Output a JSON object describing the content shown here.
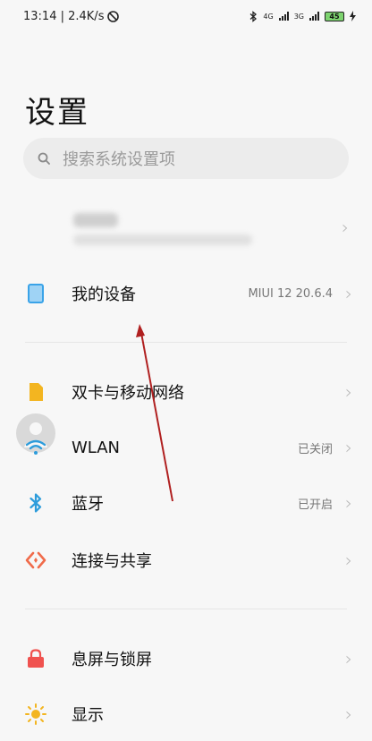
{
  "status_bar": {
    "time_speed": "13:14 | 2.4K/s",
    "signal1_label": "4G",
    "signal2_label": "3G",
    "battery": "45"
  },
  "page": {
    "title": "设置"
  },
  "search": {
    "placeholder": "搜索系统设置项"
  },
  "items": {
    "my_device": {
      "label": "我的设备",
      "value": "MIUI 12 20.6.4"
    },
    "sim": {
      "label": "双卡与移动网络"
    },
    "wlan": {
      "label": "WLAN",
      "value": "已关闭"
    },
    "bluetooth": {
      "label": "蓝牙",
      "value": "已开启"
    },
    "connection": {
      "label": "连接与共享"
    },
    "lockscreen": {
      "label": "息屏与锁屏"
    },
    "display": {
      "label": "显示"
    }
  },
  "colors": {
    "my_device_icon": "#3aa3e8",
    "sim_icon": "#f3b520",
    "wlan_icon": "#2d9cdb",
    "bluetooth_icon": "#2d9cdb",
    "connection_icon": "#f06b4a",
    "lockscreen_icon": "#f0524f",
    "display_icon": "#f3b520",
    "annotation_arrow": "#b02020"
  }
}
